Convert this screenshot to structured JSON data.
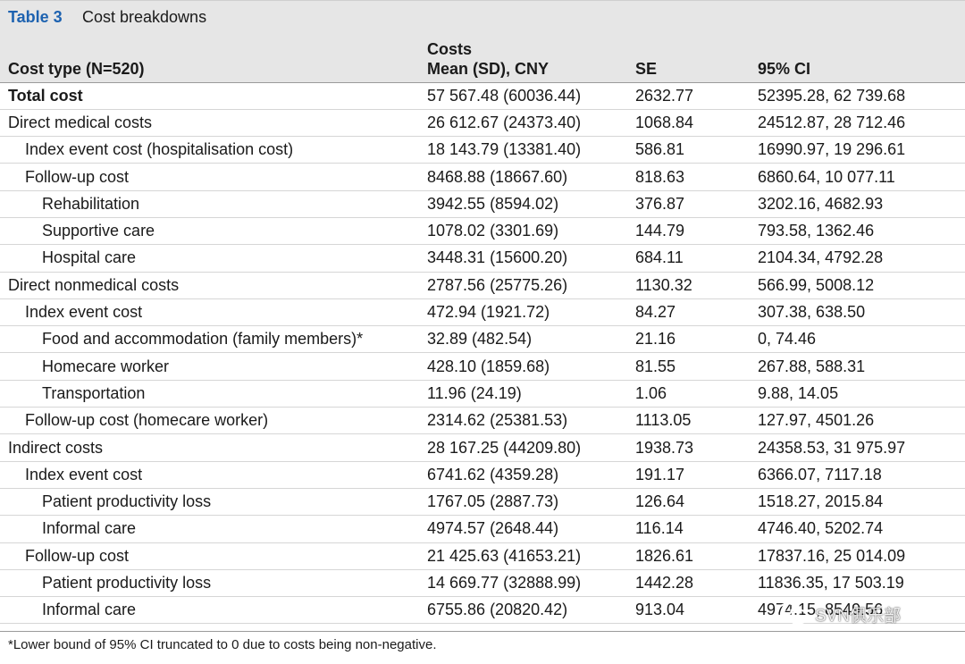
{
  "caption": {
    "label": "Table 3",
    "title": "Cost breakdowns"
  },
  "header": {
    "col1": "Cost type (N=520)",
    "col2_top": "Costs",
    "col2": "Mean (SD), CNY",
    "col3": "SE",
    "col4": "95% CI"
  },
  "rows": [
    {
      "type": "Total cost",
      "level": 0,
      "bold": true,
      "mean": "57 567.48 (60036.44)",
      "se": "2632.77",
      "ci": "52395.28, 62 739.68"
    },
    {
      "type": "Direct medical costs",
      "level": 0,
      "mean": "26 612.67 (24373.40)",
      "se": "1068.84",
      "ci": "24512.87, 28 712.46"
    },
    {
      "type": "Index event cost (hospitalisation cost)",
      "level": 1,
      "mean": "18 143.79 (13381.40)",
      "se": "586.81",
      "ci": "16990.97, 19 296.61"
    },
    {
      "type": "Follow-up cost",
      "level": 1,
      "mean": "8468.88 (18667.60)",
      "se": "818.63",
      "ci": "6860.64, 10 077.11"
    },
    {
      "type": "Rehabilitation",
      "level": 2,
      "mean": "3942.55 (8594.02)",
      "se": "376.87",
      "ci": "3202.16, 4682.93"
    },
    {
      "type": "Supportive care",
      "level": 2,
      "mean": "1078.02 (3301.69)",
      "se": "144.79",
      "ci": "793.58, 1362.46"
    },
    {
      "type": "Hospital care",
      "level": 2,
      "mean": "3448.31 (15600.20)",
      "se": "684.11",
      "ci": "2104.34, 4792.28"
    },
    {
      "type": "Direct nonmedical costs",
      "level": 0,
      "mean": "2787.56 (25775.26)",
      "se": "1130.32",
      "ci": "566.99, 5008.12"
    },
    {
      "type": "Index event cost",
      "level": 1,
      "mean": "472.94 (1921.72)",
      "se": "84.27",
      "ci": "307.38, 638.50"
    },
    {
      "type": "Food and accommodation (family members)*",
      "level": 2,
      "mean": "32.89 (482.54)",
      "se": "21.16",
      "ci": "0, 74.46"
    },
    {
      "type": "Homecare worker",
      "level": 2,
      "mean": "428.10 (1859.68)",
      "se": "81.55",
      "ci": "267.88, 588.31"
    },
    {
      "type": "Transportation",
      "level": 2,
      "mean": "11.96 (24.19)",
      "se": "1.06",
      "ci": "9.88, 14.05"
    },
    {
      "type": "Follow-up cost (homecare worker)",
      "level": 1,
      "mean": "2314.62 (25381.53)",
      "se": "1113.05",
      "ci": "127.97, 4501.26"
    },
    {
      "type": "Indirect costs",
      "level": 0,
      "mean": "28 167.25 (44209.80)",
      "se": "1938.73",
      "ci": "24358.53, 31 975.97"
    },
    {
      "type": "Index event cost",
      "level": 1,
      "mean": "6741.62 (4359.28)",
      "se": "191.17",
      "ci": "6366.07, 7117.18"
    },
    {
      "type": "Patient productivity loss",
      "level": 2,
      "mean": "1767.05 (2887.73)",
      "se": "126.64",
      "ci": "1518.27, 2015.84"
    },
    {
      "type": "Informal care",
      "level": 2,
      "mean": "4974.57 (2648.44)",
      "se": "116.14",
      "ci": "4746.40, 5202.74"
    },
    {
      "type": "Follow-up cost",
      "level": 1,
      "mean": "21 425.63 (41653.21)",
      "se": "1826.61",
      "ci": "17837.16, 25 014.09"
    },
    {
      "type": "Patient productivity loss",
      "level": 2,
      "mean": "14 669.77 (32888.99)",
      "se": "1442.28",
      "ci": "11836.35, 17 503.19"
    },
    {
      "type": "Informal care",
      "level": 2,
      "mean": "6755.86 (20820.42)",
      "se": "913.04",
      "ci": "4974.15, 8549.56"
    }
  ],
  "footnote": "*Lower bound of 95% CI truncated to 0 due to costs being non-negative.",
  "watermark": {
    "text": "SVN俱乐部",
    "icon": "wechat-icon"
  }
}
